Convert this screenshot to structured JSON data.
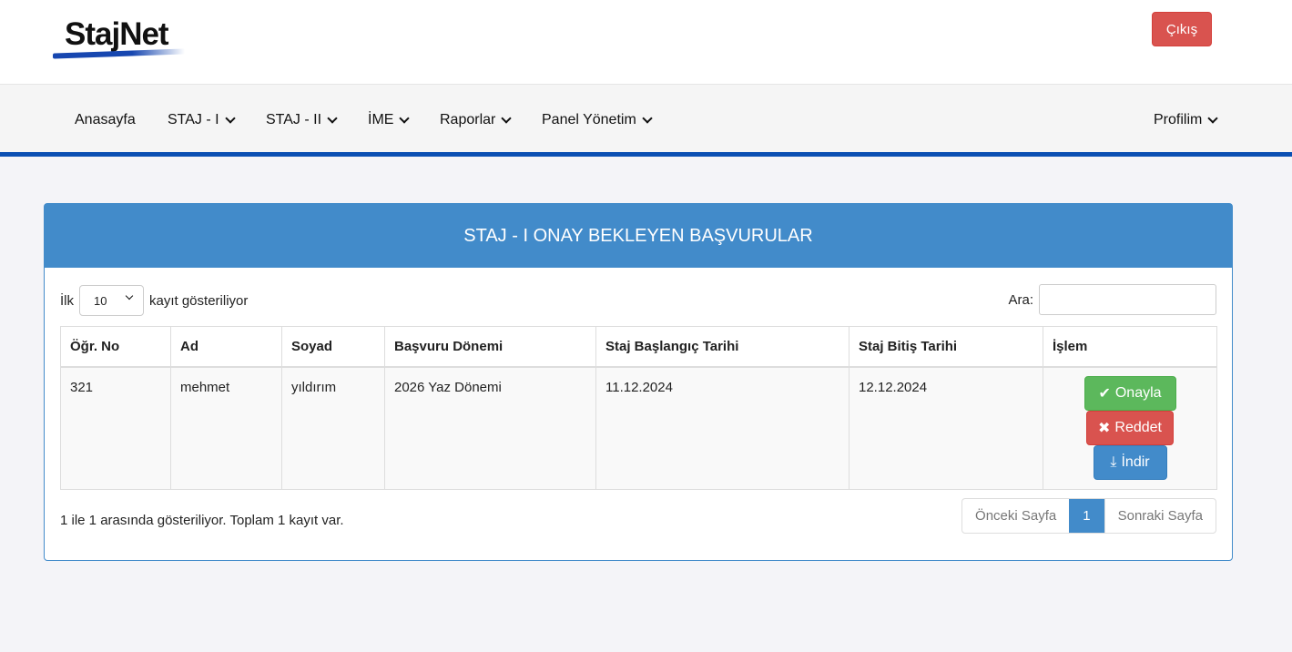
{
  "header": {
    "logo": "StajNet",
    "logout": "Çıkış"
  },
  "nav": {
    "items": [
      "Anasayfa",
      "STAJ - I",
      "STAJ - II",
      "İME",
      "Raporlar",
      "Panel Yönetim"
    ],
    "profile": "Profilim"
  },
  "panel": {
    "title": "STAJ - I ONAY BEKLEYEN BAŞVURULAR",
    "length_prefix": "İlk",
    "length_value": "10",
    "length_suffix": "kayıt gösteriliyor",
    "search_label": "Ara:",
    "search_value": "",
    "columns": [
      "Öğr. No",
      "Ad",
      "Soyad",
      "Başvuru Dönemi",
      "Staj Başlangıç Tarihi",
      "Staj Bitiş Tarihi",
      "İşlem"
    ],
    "rows": [
      {
        "no": "321",
        "ad": "mehmet",
        "soyad": "yıldırım",
        "donem": "2026 Yaz Dönemi",
        "baslangic": "11.12.2024",
        "bitis": "12.12.2024"
      }
    ],
    "actions": {
      "approve": "Onayla",
      "reject": "Reddet",
      "download": "İndir"
    },
    "info": "1 ile 1 arasında gösteriliyor. Toplam 1 kayıt var.",
    "pager": {
      "prev": "Önceki Sayfa",
      "current": "1",
      "next": "Sonraki Sayfa"
    }
  },
  "colors": {
    "primary": "#428bca",
    "success": "#5cb85c",
    "danger": "#d9534f",
    "nav_border": "#0b4fb3"
  }
}
